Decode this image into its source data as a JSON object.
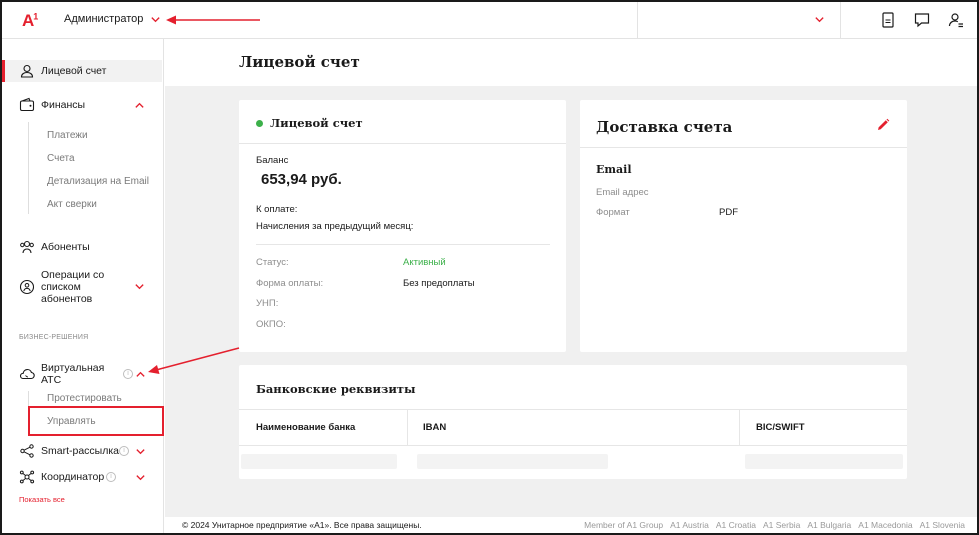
{
  "header": {
    "logo": "A",
    "logo_sup": "1",
    "role": "Администратор",
    "icons": [
      "document-icon",
      "chat-icon",
      "user-settings-icon"
    ]
  },
  "sidebar": {
    "account": "Лицевой счет",
    "finance": {
      "label": "Финансы",
      "items": [
        "Платежи",
        "Счета",
        "Детализация на Email",
        "Акт сверки"
      ]
    },
    "subscribers": "Абоненты",
    "operations": "Операции со списком абонентов",
    "section_business": "БИЗНЕС-РЕШЕНИЯ",
    "pbx": {
      "label": "Виртуальная АТС",
      "items": [
        "Протестировать",
        "Управлять"
      ]
    },
    "smart": "Smart-рассылка",
    "coordinator": "Координатор",
    "show_all": "Показать все"
  },
  "main": {
    "page_title": "Лицевой счет",
    "account_card": {
      "title": "Лицевой счет",
      "balance_label": "Баланс",
      "balance_value": "653,94 руб.",
      "to_pay": "К оплате:",
      "charges": "Начисления за предыдущий месяц:",
      "status_label": "Статус:",
      "status_value": "Активный",
      "payment_form_label": "Форма оплаты:",
      "payment_form_value": "Без предоплаты",
      "unp_label": "УНП:",
      "okpo_label": "ОКПО:"
    },
    "delivery_card": {
      "title": "Доставка счета",
      "email_title": "Email",
      "email_address_label": "Email адрес",
      "format_label": "Формат",
      "format_value": "PDF"
    },
    "bank_card": {
      "title": "Банковские реквизиты",
      "columns": [
        "Наименование банка",
        "IBAN",
        "BIC/SWIFT"
      ]
    }
  },
  "footer": {
    "copyright": "© 2024 Унитарное предприятие «А1». Все права защищены.",
    "links": [
      "Member of A1 Group",
      "A1 Austria",
      "A1 Croatia",
      "A1 Serbia",
      "A1 Bulgaria",
      "A1 Macedonia",
      "A1 Slovenia"
    ]
  },
  "colors": {
    "brand_red": "#e4202e",
    "status_green": "#3cb04a",
    "background": "#f0f0f0"
  }
}
